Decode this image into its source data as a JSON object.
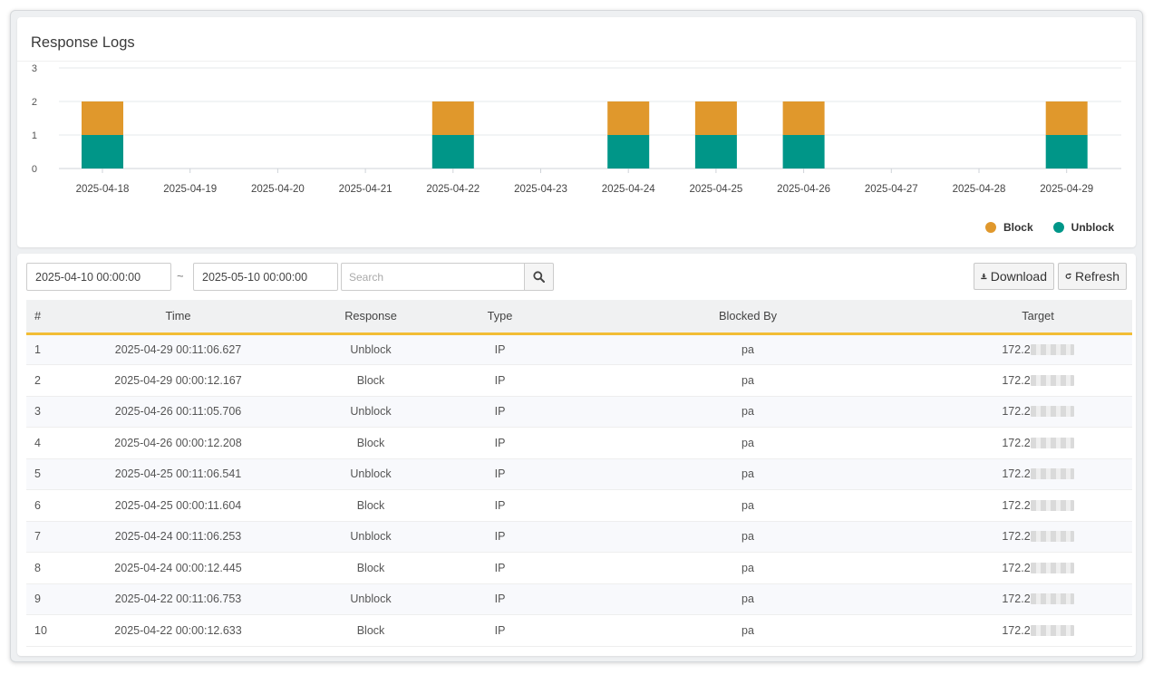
{
  "header": {
    "title": "Response Logs"
  },
  "chart_data": {
    "type": "bar",
    "stacked": true,
    "categories": [
      "2025-04-18",
      "2025-04-19",
      "2025-04-20",
      "2025-04-21",
      "2025-04-22",
      "2025-04-23",
      "2025-04-24",
      "2025-04-25",
      "2025-04-26",
      "2025-04-27",
      "2025-04-28",
      "2025-04-29"
    ],
    "series": [
      {
        "name": "Unblock",
        "color": "#009688",
        "values": [
          1,
          0,
          0,
          0,
          1,
          0,
          1,
          1,
          1,
          0,
          0,
          1
        ]
      },
      {
        "name": "Block",
        "color": "#e0982c",
        "values": [
          1,
          0,
          0,
          0,
          1,
          0,
          1,
          1,
          1,
          0,
          0,
          1
        ]
      }
    ],
    "yticks": [
      0,
      1,
      2,
      3
    ],
    "ylim": [
      0,
      3
    ],
    "grid": true,
    "legend_position": "bottom-right"
  },
  "filters": {
    "date_from": "2025-04-10 00:00:00",
    "separator": "~",
    "date_to": "2025-05-10 00:00:00",
    "search_placeholder": "Search"
  },
  "buttons": {
    "download": "Download",
    "refresh": "Refresh"
  },
  "table": {
    "columns": [
      "#",
      "Time",
      "Response",
      "Type",
      "Blocked By",
      "Target"
    ],
    "rows": [
      {
        "num": "1",
        "time": "2025-04-29 00:11:06.627",
        "response": "Unblock",
        "type": "IP",
        "by": "pa",
        "target": "172.2"
      },
      {
        "num": "2",
        "time": "2025-04-29 00:00:12.167",
        "response": "Block",
        "type": "IP",
        "by": "pa",
        "target": "172.2"
      },
      {
        "num": "3",
        "time": "2025-04-26 00:11:05.706",
        "response": "Unblock",
        "type": "IP",
        "by": "pa",
        "target": "172.2"
      },
      {
        "num": "4",
        "time": "2025-04-26 00:00:12.208",
        "response": "Block",
        "type": "IP",
        "by": "pa",
        "target": "172.2"
      },
      {
        "num": "5",
        "time": "2025-04-25 00:11:06.541",
        "response": "Unblock",
        "type": "IP",
        "by": "pa",
        "target": "172.2"
      },
      {
        "num": "6",
        "time": "2025-04-25 00:00:11.604",
        "response": "Block",
        "type": "IP",
        "by": "pa",
        "target": "172.2"
      },
      {
        "num": "7",
        "time": "2025-04-24 00:11:06.253",
        "response": "Unblock",
        "type": "IP",
        "by": "pa",
        "target": "172.2"
      },
      {
        "num": "8",
        "time": "2025-04-24 00:00:12.445",
        "response": "Block",
        "type": "IP",
        "by": "pa",
        "target": "172.2"
      },
      {
        "num": "9",
        "time": "2025-04-22 00:11:06.753",
        "response": "Unblock",
        "type": "IP",
        "by": "pa",
        "target": "172.2"
      },
      {
        "num": "10",
        "time": "2025-04-22 00:00:12.633",
        "response": "Block",
        "type": "IP",
        "by": "pa",
        "target": "172.2"
      }
    ]
  },
  "icons": {
    "search": "search-icon",
    "download": "download-icon",
    "refresh": "refresh-icon"
  }
}
